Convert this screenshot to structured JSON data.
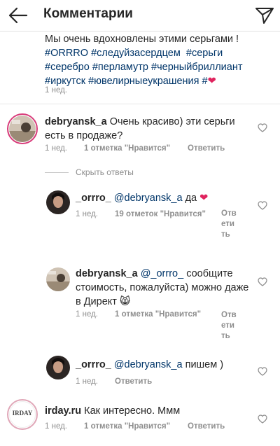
{
  "header": {
    "title": "Комментарии"
  },
  "caption": {
    "line1": "Мы очень вдохновлены этими серьгами !",
    "tags1": [
      "#ORRRO",
      "#следуйзасердцем",
      "#серьги"
    ],
    "tags2": [
      "#серебро",
      "#перламутр",
      "#черныйбриллиант"
    ],
    "tags3": [
      "#иркутск",
      "#ювелирныеукрашения",
      "#"
    ],
    "heart": "❤",
    "time": "1 нед."
  },
  "comments": {
    "c1": {
      "user": "debryansk_a",
      "text": "Очень красиво) эти серьги есть в продаже?",
      "time": "1 нед.",
      "likes": "1 отметка \"Нравится\"",
      "reply": "Ответить"
    },
    "hide_replies": "Скрыть ответы",
    "r1": {
      "user": "_orrro_",
      "mention": "@debryansk_a",
      "text": "да",
      "heart": "❤",
      "time": "1 нед.",
      "likes": "19 отметок \"Нравится\"",
      "reply": "Ответить"
    },
    "r2": {
      "user": "debryansk_a",
      "mention": "@_orrro_",
      "text": "сообщите стоимость, пожалуйста) можно даже в Директ",
      "emoji": "😸",
      "time": "1 нед.",
      "likes": "1 отметка \"Нравится\"",
      "reply": "Ответить"
    },
    "r3": {
      "user": "_orrro_",
      "mention": "@debryansk_a",
      "text": "пишем )",
      "time": "1 нед.",
      "reply": "Ответить"
    },
    "c2": {
      "user": "irday.ru",
      "text": "Как интересно. Ммм",
      "avatar_text": "IRDAY",
      "time": "1 нед.",
      "likes": "1 отметка \"Нравится\"",
      "reply": "Ответить"
    }
  },
  "colors": {
    "link": "#003569",
    "muted": "#8e8e8e",
    "heart": "#e0245e",
    "ring": "#d83b7a"
  }
}
